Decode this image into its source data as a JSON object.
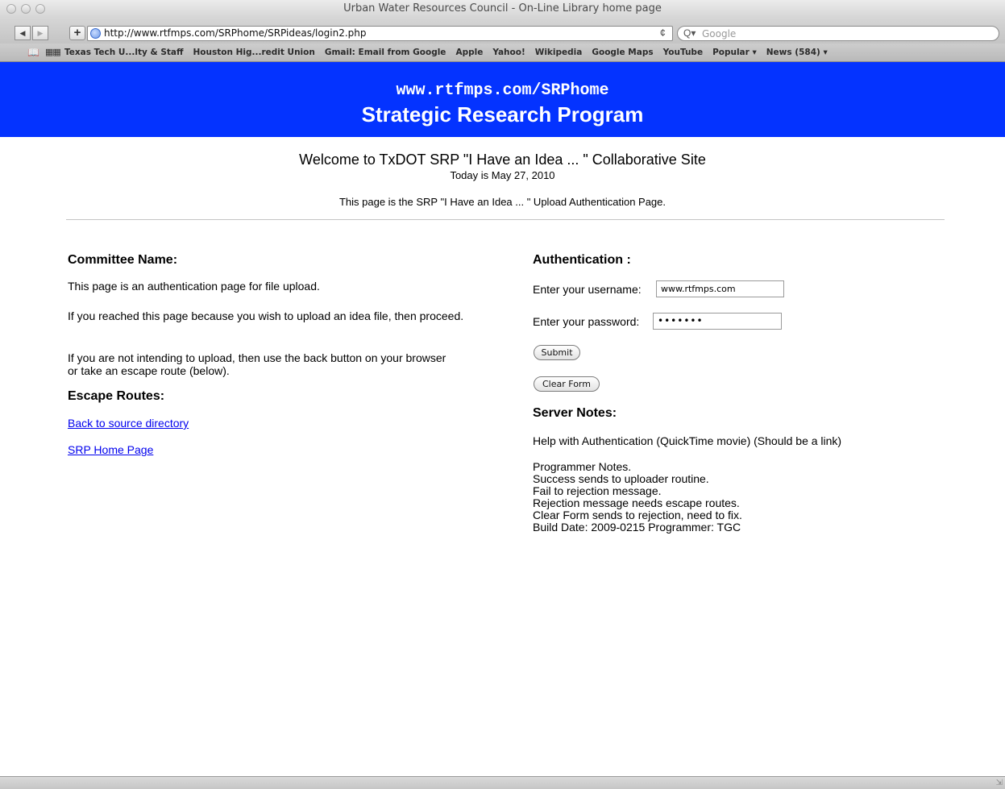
{
  "window": {
    "title": "Urban Water Resources Council - On-Line Library home page"
  },
  "toolbar": {
    "back_glyph": "◀",
    "forward_glyph": "▶",
    "add_glyph": "+",
    "url": "http://www.rtfmps.com/SRPhome/SRPideas/login2.php",
    "reload_glyph": "¢",
    "search_placeholder": "Google",
    "search_glyph": "Q▾"
  },
  "bookmarks": {
    "items": [
      "Texas Tech U...lty & Staff",
      "Houston Hig...redit Union",
      "Gmail: Email from Google",
      "Apple",
      "Yahoo!",
      "Wikipedia",
      "Google Maps",
      "YouTube",
      "Popular ▾",
      "News (584) ▾"
    ]
  },
  "banner": {
    "url": "www.rtfmps.com/SRPhome",
    "title": "Strategic Research Program",
    "bg_color": "#0433ff"
  },
  "header": {
    "welcome": "Welcome to TxDOT SRP \"I Have an Idea ... \" Collaborative Site",
    "today": "Today is May 27, 2010",
    "intro": "This page is the SRP \"I Have an Idea ... \" Upload Authentication Page."
  },
  "left": {
    "committee_heading": "Committee Name:",
    "p1": "This page is an authentication page for file upload.",
    "p2": "If you reached this page because you wish to upload an idea file, then proceed.",
    "p3": "If you are not intending to upload, then use the back button on your browser or take an escape route (below).",
    "escape_heading": "Escape Routes:",
    "link1": "Back to source directory",
    "link2": "SRP Home Page"
  },
  "right": {
    "auth_heading": "Authentication :",
    "username_label": "Enter your username:",
    "username_value": "www.rtfmps.com",
    "password_label": "Enter your password:",
    "password_value": "•••••••",
    "submit_label": "Submit",
    "clear_label": "Clear Form",
    "server_heading": "Server Notes:",
    "help_text": "Help with Authentication (QuickTime movie) (Should be a link)",
    "notes": [
      "Programmer Notes.",
      "Success sends to uploader routine.",
      "Fail to rejection message.",
      "Rejection message needs escape routes.",
      "Clear Form sends to rejection, need to fix.",
      "Build Date: 2009-0215 Programmer: TGC"
    ]
  }
}
